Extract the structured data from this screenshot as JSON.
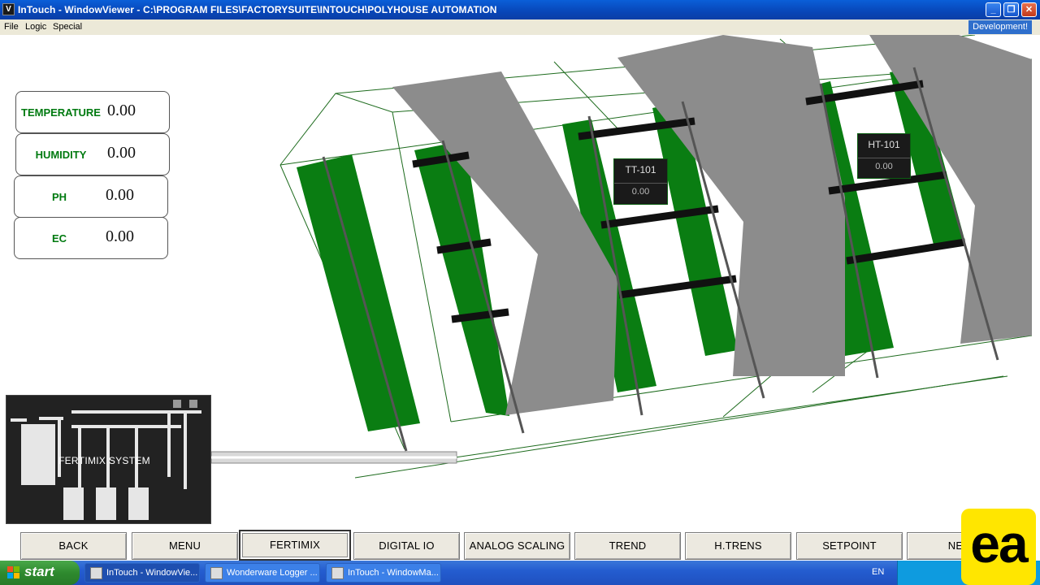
{
  "window": {
    "title": "InTouch - WindowViewer - C:\\PROGRAM FILES\\FACTORYSUITE\\INTOUCH\\POLYHOUSE AUTOMATION",
    "app_icon": "V",
    "minimize_icon": "minimize-icon",
    "maximize_icon": "restore-icon",
    "close_icon": "close-icon"
  },
  "menubar": {
    "items": [
      "File",
      "Logic",
      "Special"
    ],
    "development": "Development!"
  },
  "readouts": [
    {
      "label": "TEMPERATURE",
      "value": "0.00"
    },
    {
      "label": "HUMIDITY",
      "value": "0.00"
    },
    {
      "label": "PH",
      "value": "0.00"
    },
    {
      "label": "EC",
      "value": "0.00"
    }
  ],
  "tags": [
    {
      "name": "TT-101",
      "value": "0.00"
    },
    {
      "name": "HT-101",
      "value": "0.00"
    }
  ],
  "fertimix": {
    "label": "FERTIMIX SYSTEM"
  },
  "nav": {
    "buttons": [
      "BACK",
      "MENU",
      "FERTIMIX",
      "DIGITAL IO",
      "ANALOG SCALING",
      "TREND",
      "H.TRENS",
      "SETPOINT",
      "NE"
    ],
    "active": "FERTIMIX"
  },
  "taskbar": {
    "start": "start",
    "tasks": [
      "InTouch - WindowVie...",
      "Wonderware Logger ...",
      "InTouch - WindowMa..."
    ],
    "lang": "EN"
  },
  "watermark": "ea",
  "colors": {
    "green": "#0a7d12",
    "roof_gray": "#8c8c8c",
    "label_green": "#007a10"
  }
}
